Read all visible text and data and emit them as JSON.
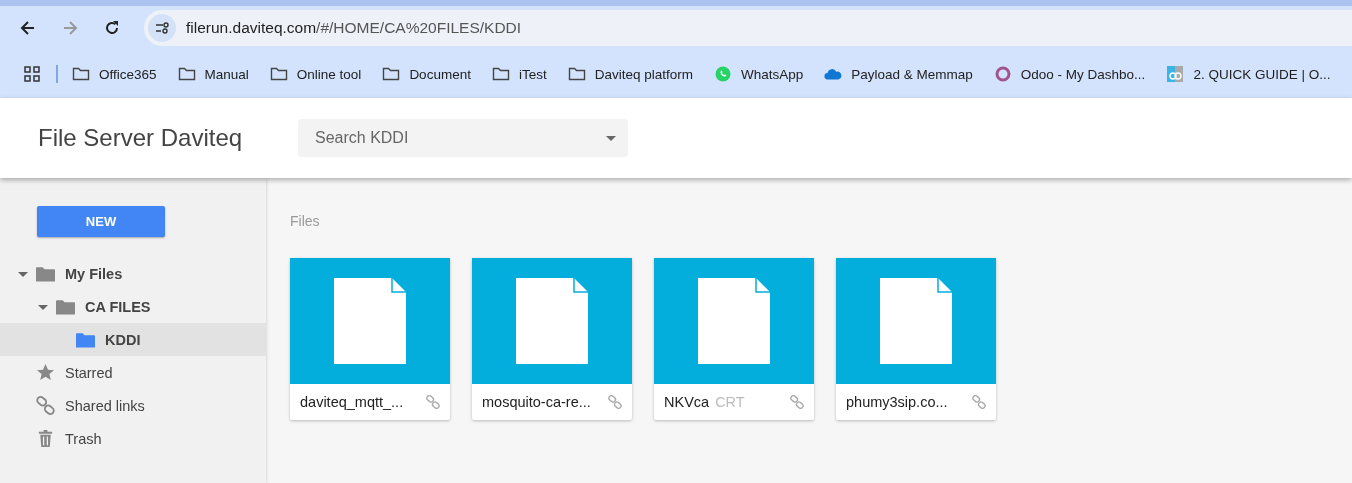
{
  "browser": {
    "url_host": "filerun.daviteq.com",
    "url_path": "/#/HOME/CA%20FILES/KDDI"
  },
  "bookmarks": [
    {
      "label": "Office365",
      "kind": "folder"
    },
    {
      "label": "Manual",
      "kind": "folder"
    },
    {
      "label": "Online tool",
      "kind": "folder"
    },
    {
      "label": "Document",
      "kind": "folder"
    },
    {
      "label": "iTest",
      "kind": "folder"
    },
    {
      "label": "Daviteq platform",
      "kind": "folder"
    },
    {
      "label": "WhatsApp",
      "kind": "chat"
    },
    {
      "label": "Payload & Memmap",
      "kind": "cloud"
    },
    {
      "label": "Odoo - My Dashbo...",
      "kind": "ring"
    },
    {
      "label": "2. QUICK GUIDE | O...",
      "kind": "site"
    }
  ],
  "app": {
    "title": "File Server Daviteq",
    "search": {
      "placeholder": "Search KDDI"
    }
  },
  "sidebar": {
    "new_button": "NEW",
    "tree": [
      {
        "label": "My Files",
        "expanded": true,
        "selected": false,
        "children": [
          {
            "label": "CA FILES",
            "expanded": true,
            "selected": false,
            "children": [
              {
                "label": "KDDI",
                "selected": true
              }
            ]
          }
        ]
      }
    ],
    "links": [
      {
        "label": "Starred",
        "kind": "star"
      },
      {
        "label": "Shared links",
        "kind": "link"
      },
      {
        "label": "Trash",
        "kind": "trash"
      }
    ]
  },
  "main": {
    "section_title": "Files",
    "files": [
      {
        "name": "daviteq_mqtt_..."
      },
      {
        "name": "mosquito-ca-re..."
      },
      {
        "name": "NKVca",
        "ext": "CRT"
      },
      {
        "name": "phumy3sip.co..."
      }
    ]
  }
}
